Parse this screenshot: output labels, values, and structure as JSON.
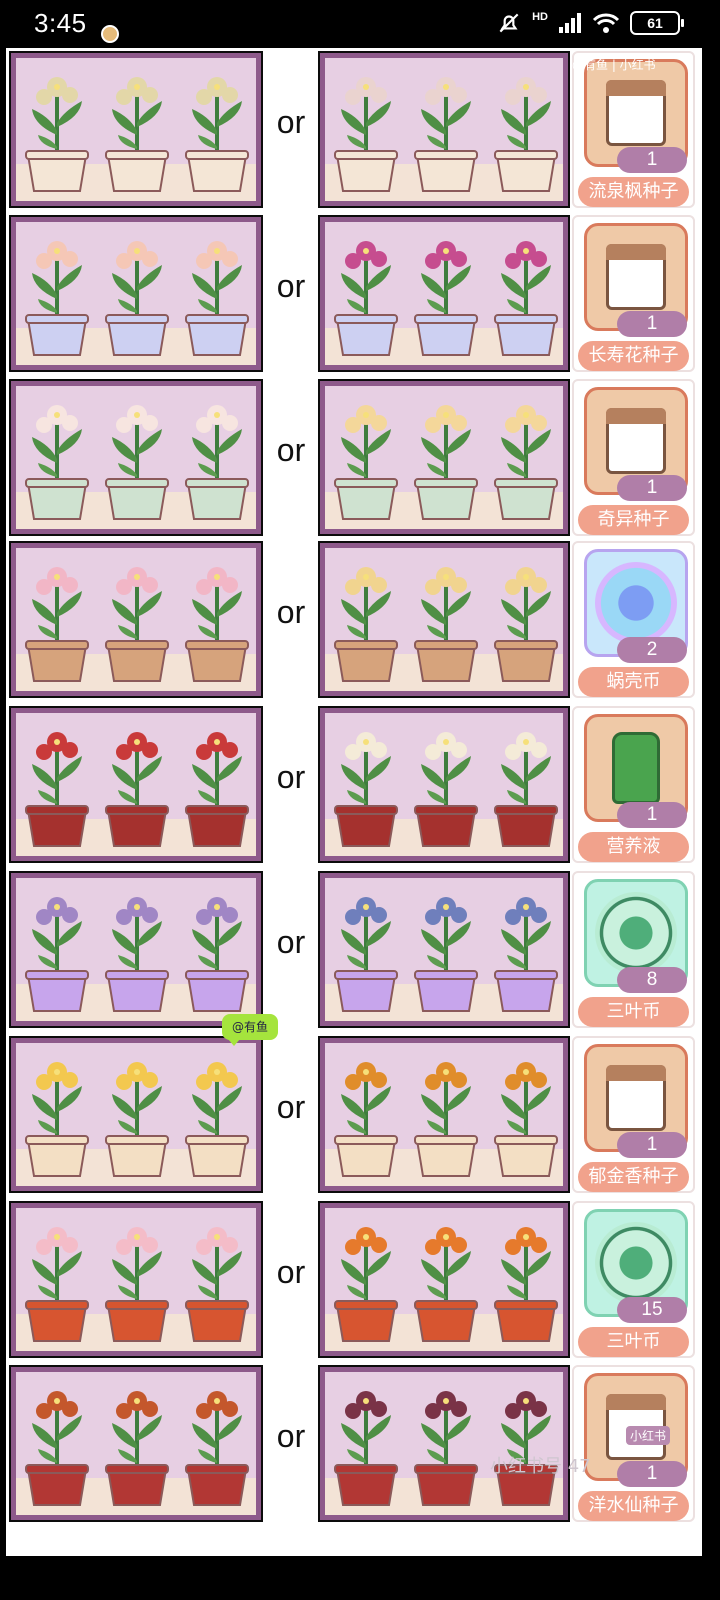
{
  "status_bar": {
    "time": "3:45",
    "network": "HD",
    "battery": "61"
  },
  "rows": [
    {
      "or": "or",
      "reward_qty": "1",
      "reward_name": "流泉枫种子",
      "reward_icon": "seed-packet-icon",
      "pot": "#f4e6d6",
      "flower": "#e3d7a8",
      "alt_flower": "#ead3cf"
    },
    {
      "or": "or",
      "reward_qty": "1",
      "reward_name": "长寿花种子",
      "reward_icon": "seed-packet-icon",
      "pot": "#cdd0f2",
      "flower": "#f5c7b6",
      "alt_flower": "#c64d8f"
    },
    {
      "or": "or",
      "reward_qty": "1",
      "reward_name": "奇异种子",
      "reward_icon": "seed-packet-icon",
      "pot": "#cfe2d0",
      "flower": "#f7e5e0",
      "alt_flower": "#f4d79a"
    },
    {
      "or": "or",
      "reward_qty": "2",
      "reward_name": "蜗壳币",
      "reward_icon": "snail-coin-icon",
      "pot": "#d6a37c",
      "flower": "#f2b6c6",
      "alt_flower": "#f1d48f"
    },
    {
      "or": "or",
      "reward_qty": "1",
      "reward_name": "营养液",
      "reward_icon": "nutrient-bottle-icon",
      "pot": "#a5312e",
      "flower": "#c93a3a",
      "alt_flower": "#f4ebd8"
    },
    {
      "or": "or",
      "reward_qty": "8",
      "reward_name": "三叶币",
      "reward_icon": "clover-coin-icon",
      "pot": "#c7a5ec",
      "flower": "#a086c5",
      "alt_flower": "#6f7fbc"
    },
    {
      "or": "or",
      "reward_qty": "1",
      "reward_name": "郁金香种子",
      "reward_icon": "seed-packet-icon",
      "pot": "#f3dfc4",
      "flower": "#f3c84f",
      "alt_flower": "#e08d2b"
    },
    {
      "or": "or",
      "reward_qty": "15",
      "reward_name": "三叶币",
      "reward_icon": "clover-coin-icon",
      "pot": "#d75530",
      "flower": "#f4bcc8",
      "alt_flower": "#e67a2c"
    },
    {
      "or": "or",
      "reward_qty": "1",
      "reward_name": "洋水仙种子",
      "reward_icon": "seed-packet-icon",
      "pot": "#b23734",
      "flower": "#c4572c",
      "alt_flower": "#7a3347"
    }
  ],
  "tag_text": "@有鱼",
  "watermark_top": "@有鱼 | 小红书",
  "watermark_bottom": "小红书号 47",
  "watermark_badge": "小红书"
}
